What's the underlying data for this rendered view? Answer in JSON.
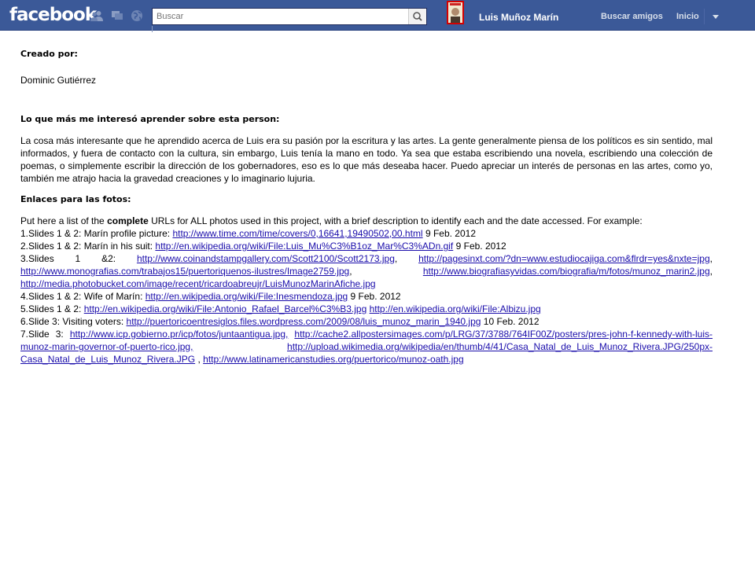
{
  "topbar": {
    "logo": "facebook",
    "search_placeholder": "Buscar",
    "profile_name": "Luis Muñoz Marín",
    "nav": {
      "find_friends": "Buscar amigos",
      "home": "Inicio"
    },
    "colors": {
      "bar": "#3b5998",
      "nav_text": "#d8dfea"
    }
  },
  "content": {
    "created_label": "Creado por:",
    "author": "Dominic Gutiérrez",
    "question": "Lo que más me interesó aprender sobre esta person:",
    "answer": "La cosa más interesante que he aprendido acerca de Luis era su pasión por la escritura y las artes. La gente generalmente piensa de los políticos es sin sentido, mal informados, y fuera de contacto con la cultura, sin embargo, Luis tenía la mano en todo. Ya sea que estaba escribiendo una novela, escribiendo una colección de poemas, o simplemente escribir la dirección de los gobernadores, eso es lo que más deseaba hacer. Puedo apreciar un interés de personas en las artes, como yo, también me atrajo hacia la gravedad creaciones y lo imaginario lujuria.",
    "links_heading": "Enlaces para las fotos:",
    "intro_a": "Put here  a list of the ",
    "intro_bold": "complete",
    "intro_b": " URLs  for ALL photos used in this project, with a brief description to identify each and the date accessed. For example:",
    "items": [
      {
        "t0": "1.Slides 1 & 2: Marín  profile picture: ",
        "u0": "http://www.time.com/time/covers/0,16641,19490502,00.html",
        "t1": " 9 Feb. 2012"
      },
      {
        "t0": "2.Slides 1 & 2: Marín  in his suit: ",
        "u0": "http://en.wikipedia.org/wiki/File:Luis_Mu%C3%B1oz_Mar%C3%ADn.gif",
        "t1": " 9 Feb. 2012"
      },
      {
        "t0": "3.Slides  1 &2:  ",
        "u0": "http://www.coinandstampgallery.com/Scott2100/Scott2173.jpg",
        "t1": ",  ",
        "u1": "http://pagesinxt.com/?dn=www.estudiocajiga.com&flrdr=yes&nxte=jpg",
        "t2": ", ",
        "u2": "http://www.monografias.com/trabajos15/puertoriquenos-ilustres/Image2759.jpg",
        "t3": ",  ",
        "u3": "http://www.biografiasyvidas.com/biografia/m/fotos/munoz_marin2.jpg",
        "t4": ", ",
        "u4": "http://media.photobucket.com/image/recent/ricardoabreujr/LuisMunozMarinAfiche.jpg"
      },
      {
        "t0": "4.Slides 1 & 2: Wife of Marín: ",
        "u0": "http://en.wikipedia.org/wiki/File:Inesmendoza.jpg",
        "t1": " 9 Feb.  2012"
      },
      {
        "t0": "5.Slides 1 & 2: ",
        "u0": "http://en.wikipedia.org/wiki/File:Antonio_Rafael_Barcel%C3%B3.jpg",
        "t1": " ",
        "u1": "http://en.wikipedia.org/wiki/File:Albizu.jpg"
      },
      {
        "t0": "6.Slide 3: Visiting voters: ",
        "u0": "http://puertoricoentresiglos.files.wordpress.com/2009/08/luis_munoz_marin_1940.jpg",
        "t1": "  10 Feb. 2012"
      },
      {
        "t0": "7.Slide   3:    ",
        "u0": "http://www.icp.gobierno.pr/icp/fotos/juntaantigua.jpg,",
        "t1": "    ",
        "u1": "http://cache2.allpostersimages.com/p/LRG/37/3788/764IF00Z/posters/pres-john-f-kennedy-with-luis-munoz-marin-governor-of-puerto-rico.jpg,",
        "t2": " ",
        "u2": "http://upload.wikimedia.org/wikipedia/en/thumb/4/41/Casa_Natal_de_Luis_Munoz_Rivera.JPG/250px-Casa_Natal_de_Luis_Munoz_Rivera.JPG",
        "t3": "            , ",
        "u3": "http://www.latinamericanstudies.org/puertorico/munoz-oath.jpg"
      }
    ]
  }
}
